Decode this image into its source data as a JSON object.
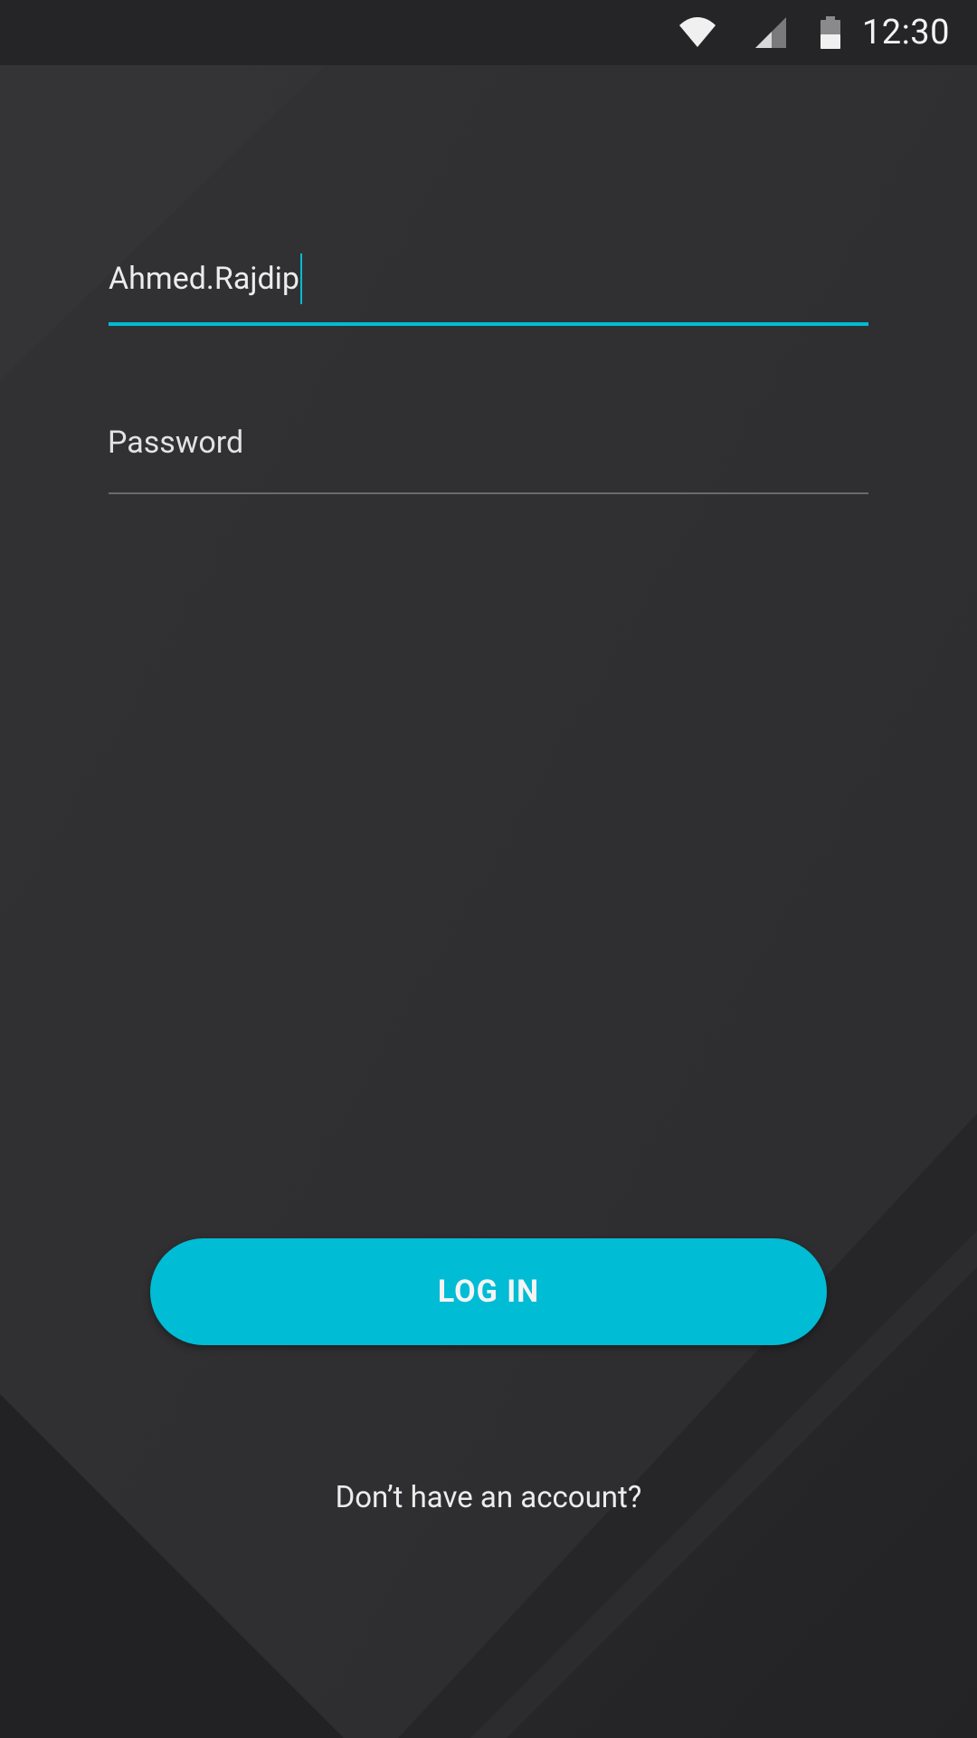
{
  "status_bar": {
    "time": "12:30",
    "icons": [
      "wifi-icon",
      "cell-signal-icon",
      "battery-icon"
    ]
  },
  "login_form": {
    "username": {
      "value": "Ahmed.Rajdip",
      "state": "focused"
    },
    "password": {
      "placeholder": "Password",
      "value": ""
    },
    "login_button_label": "LOG IN",
    "signup_link_label": "Don’t have an account?"
  },
  "colors": {
    "accent": "#00bcd4",
    "background": "#2d2d2f",
    "status_bar": "#252527",
    "text": "#ececec"
  }
}
